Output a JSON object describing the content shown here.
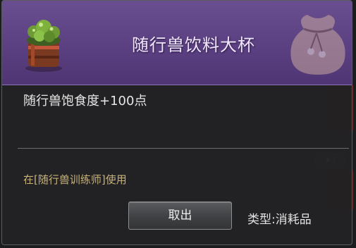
{
  "item": {
    "name": "随行兽饮料大杯",
    "description": "随行兽饱食度+100点",
    "usage": "在[随行兽训练师]使用",
    "type_label": "类型:消耗品",
    "icon": "drink-cup-icon",
    "bg_icon": "pouch-icon"
  },
  "actions": {
    "take_out_label": "取出"
  },
  "colors": {
    "header": "#5a3f80",
    "title": "#f1e6ff",
    "usage_text": "#c8b27a"
  }
}
